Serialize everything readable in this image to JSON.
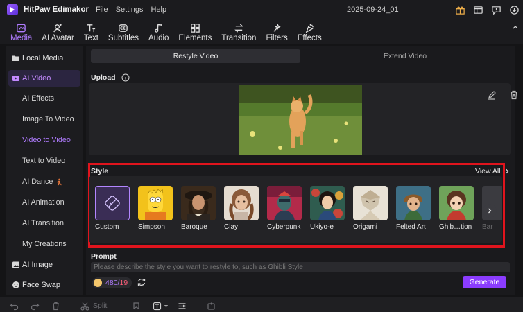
{
  "app": {
    "name": "HitPaw Edimakor",
    "menu": [
      "File",
      "Settings",
      "Help"
    ],
    "project_title": "2025-09-24_01"
  },
  "toolbar": {
    "tabs": [
      {
        "label": "Media",
        "icon": "media-icon",
        "active": true
      },
      {
        "label": "AI Avatar",
        "icon": "ai-avatar-icon",
        "active": false
      },
      {
        "label": "Text",
        "icon": "text-icon",
        "active": false
      },
      {
        "label": "Subtitles",
        "icon": "subtitles-icon",
        "active": false
      },
      {
        "label": "Audio",
        "icon": "audio-icon",
        "active": false
      },
      {
        "label": "Elements",
        "icon": "elements-icon",
        "active": false
      },
      {
        "label": "Transition",
        "icon": "transition-icon",
        "active": false
      },
      {
        "label": "Filters",
        "icon": "filters-icon",
        "active": false
      },
      {
        "label": "Effects",
        "icon": "effects-icon",
        "active": false
      }
    ]
  },
  "sidebar": {
    "local_media": "Local Media",
    "ai_video": "AI Video",
    "sub_items": [
      "AI Effects",
      "Image To Video",
      "Video to Video",
      "Text to Video",
      "AI Dance",
      "AI Animation",
      "AI Transition",
      "My Creations"
    ],
    "active_sub": "Video to Video",
    "ai_image": "AI Image",
    "face_swap": "Face Swap"
  },
  "main": {
    "tabs": [
      {
        "label": "Restyle Video",
        "active": true
      },
      {
        "label": "Extend Video",
        "active": false
      }
    ],
    "upload_label": "Upload",
    "style_label": "Style",
    "view_all": "View All",
    "styles": [
      "Custom",
      "Simpson",
      "Baroque",
      "Clay",
      "Cyberpunk",
      "Ukiyo-e",
      "Origami",
      "Felted Art",
      "Ghib…tion",
      "Bar"
    ],
    "prompt_label": "Prompt",
    "prompt_placeholder": "Please describe the style you want to restyle to, such as Ghibli Style",
    "credits": {
      "used": "480",
      "separator": "/",
      "total": "19"
    },
    "generate": "Generate"
  },
  "bottombar": {
    "split": "Split"
  },
  "colors": {
    "accent": "#8b3cff",
    "accent_text": "#b07cff",
    "highlight_frame": "#e0141d",
    "background": "#141416"
  }
}
